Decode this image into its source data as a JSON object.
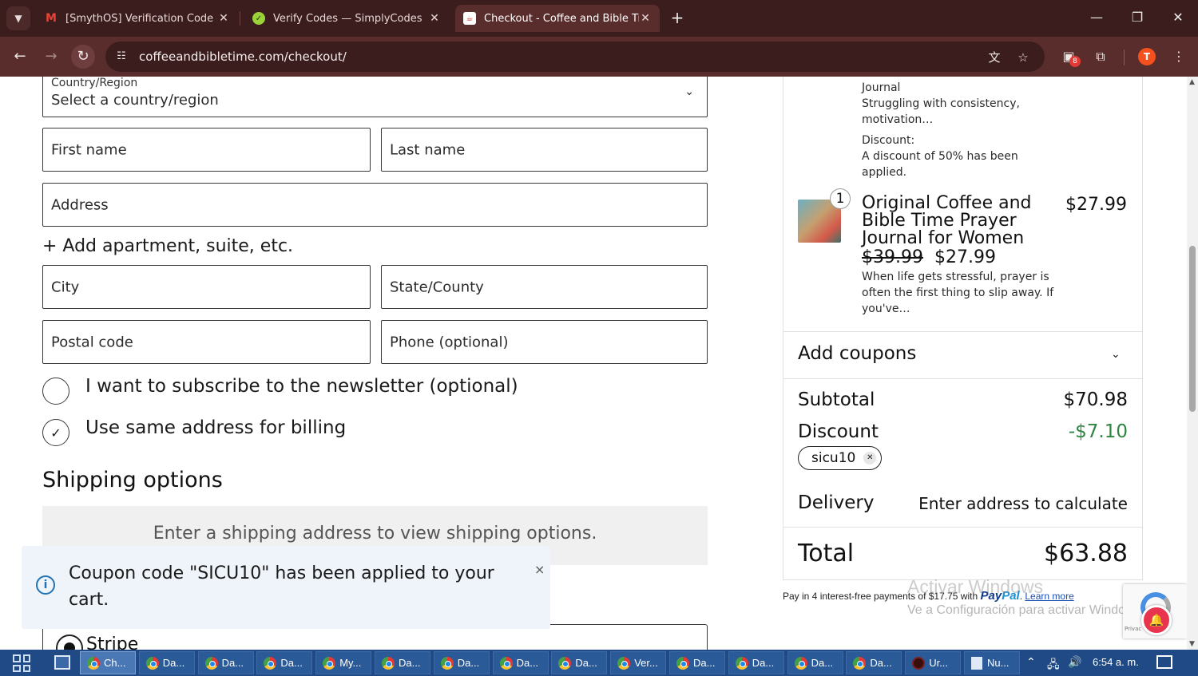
{
  "browser": {
    "tabs": [
      {
        "title": "[SmythOS] Verification Code - t",
        "favicon": "gmail-icon",
        "active": false
      },
      {
        "title": "Verify Codes — SimplyCodes",
        "favicon": "simplycodes-icon",
        "active": false
      },
      {
        "title": "Checkout - Coffee and Bible Tim",
        "favicon": "coffee-bible-icon",
        "active": true
      }
    ],
    "url": "coffeeandbibletime.com/checkout/",
    "extension_badge": "8",
    "profile_initial": "T"
  },
  "form": {
    "country_label": "Country/Region",
    "country_value": "Select a country/region",
    "first_name": "First name",
    "last_name": "Last name",
    "address": "Address",
    "add_apartment": "+ Add apartment, suite, etc.",
    "city": "City",
    "state": "State/County",
    "postal": "Postal code",
    "phone": "Phone (optional)",
    "newsletter_label": "I want to subscribe to the newsletter (optional)",
    "newsletter_checked": false,
    "billing_label": "Use same address for billing",
    "billing_checked": true
  },
  "shipping": {
    "title": "Shipping options",
    "message": "Enter a shipping address to view shipping options."
  },
  "payment": {
    "method_label": "Stripe"
  },
  "notice": {
    "text": "Coupon code \"SICU10\" has been applied to your cart.",
    "close": "×"
  },
  "summary": {
    "prev_item_name_tail": "Journal",
    "prev_item_desc": "Struggling with consistency, motivation…",
    "discount_label": "Discount:",
    "discount_desc": "A discount of 50% has been applied.",
    "item": {
      "quantity": "1",
      "name": "Original Coffee and Bible Time Prayer Journal for Women",
      "price": "$27.99",
      "old_price": "$39.99",
      "new_price": "$27.99",
      "description": "When life gets stressful, prayer is often the first thing to slip away. If you've…"
    },
    "coupons_label": "Add coupons",
    "subtotal_label": "Subtotal",
    "subtotal_value": "$70.98",
    "discount_row_label": "Discount",
    "discount_row_value": "-$7.10",
    "coupon_chip": "sicu10",
    "delivery_label": "Delivery",
    "delivery_value": "Enter address to calculate",
    "total_label": "Total",
    "total_value": "$63.88"
  },
  "paypal": {
    "text": "Pay in 4 interest-free payments of $17.75 with",
    "brand_pay": "Pay",
    "brand_pal": "Pal",
    "learn_more": "Learn more"
  },
  "watermark": {
    "line1": "Activar Windows",
    "line2": "Ve a Configuración para activar Windows."
  },
  "recaptcha": {
    "privacy_text": "Privac"
  },
  "taskbar": {
    "buttons": [
      {
        "label": "Ch...",
        "icon": "chrome",
        "active": true
      },
      {
        "label": "Da...",
        "icon": "chrome",
        "active": false
      },
      {
        "label": "Da...",
        "icon": "chrome",
        "active": false
      },
      {
        "label": "Da...",
        "icon": "chrome",
        "active": false
      },
      {
        "label": "My...",
        "icon": "chrome",
        "active": false
      },
      {
        "label": "Da...",
        "icon": "chrome",
        "active": false
      },
      {
        "label": "Da...",
        "icon": "chrome",
        "active": false
      },
      {
        "label": "Da...",
        "icon": "chrome",
        "active": false
      },
      {
        "label": "Da...",
        "icon": "chrome",
        "active": false
      },
      {
        "label": "Ver...",
        "icon": "chrome",
        "active": false
      },
      {
        "label": "Da...",
        "icon": "chrome",
        "active": false
      },
      {
        "label": "Da...",
        "icon": "chrome",
        "active": false
      },
      {
        "label": "Da...",
        "icon": "chrome",
        "active": false
      },
      {
        "label": "Da...",
        "icon": "chrome",
        "active": false
      },
      {
        "label": "Ur...",
        "icon": "dark-app",
        "active": false
      },
      {
        "label": "Nu...",
        "icon": "notepad",
        "active": false
      }
    ],
    "time": "6:54 a. m."
  }
}
